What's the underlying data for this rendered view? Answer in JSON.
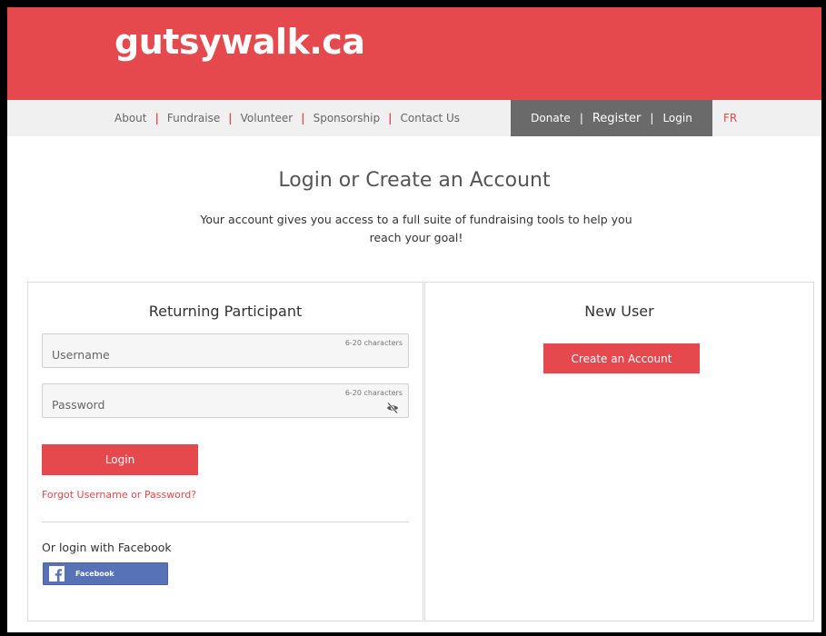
{
  "header": {
    "logo_text": "gutsywalk.ca"
  },
  "nav": {
    "items": [
      "About",
      "Fundraise",
      "Volunteer",
      "Sponsorship",
      "Contact Us"
    ],
    "donate": "Donate",
    "register": "Register",
    "login": "Login",
    "language": "FR"
  },
  "intro": {
    "title": "Login or Create an Account",
    "subtitle": "Your account gives you access to a full suite of fundraising tools to help you reach your goal!"
  },
  "returning": {
    "heading": "Returning Participant",
    "username_placeholder": "Username",
    "username_hint": "6-20 characters",
    "password_placeholder": "Password",
    "password_hint": "6-20 characters",
    "login_button": "Login",
    "forgot_link": "Forgot Username or Password?",
    "facebook_label": "Or login with Facebook",
    "facebook_button": "Facebook"
  },
  "new_user": {
    "heading": "New User",
    "create_button": "Create an Account"
  },
  "colors": {
    "brand_red": "#e5484d",
    "nav_dark": "#6a6a6a",
    "facebook_blue": "#5872b8"
  },
  "icons": {
    "password_toggle": "eye-slash-icon",
    "facebook": "facebook-logo-icon"
  }
}
